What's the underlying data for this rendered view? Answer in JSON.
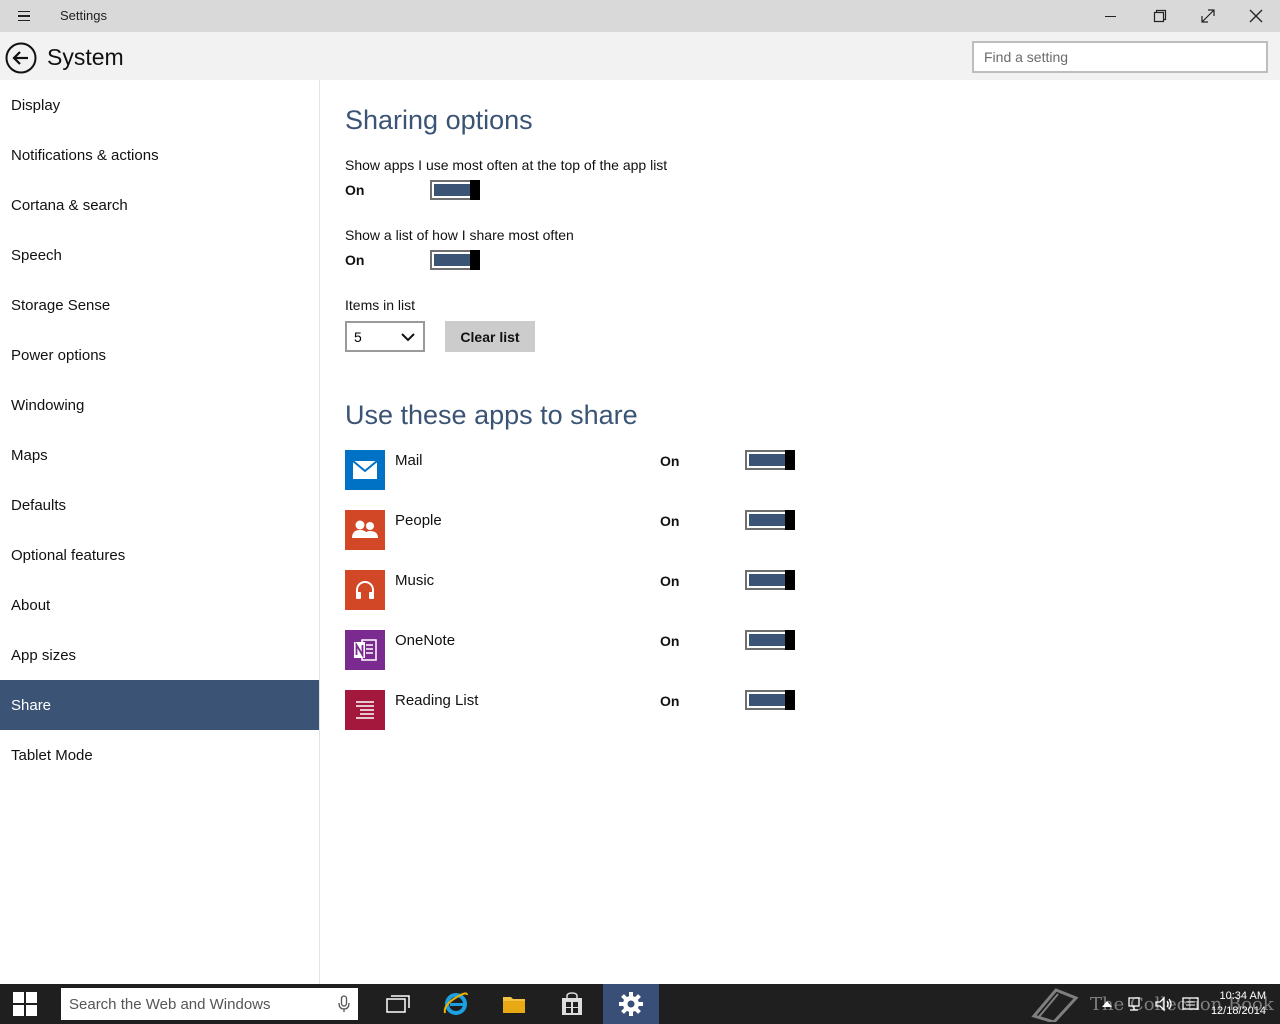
{
  "window": {
    "title": "Settings"
  },
  "header": {
    "title": "System",
    "search_placeholder": "Find a setting"
  },
  "sidebar": {
    "items": [
      {
        "label": "Display"
      },
      {
        "label": "Notifications & actions"
      },
      {
        "label": "Cortana & search"
      },
      {
        "label": "Speech"
      },
      {
        "label": "Storage Sense"
      },
      {
        "label": "Power options"
      },
      {
        "label": "Windowing"
      },
      {
        "label": "Maps"
      },
      {
        "label": "Defaults"
      },
      {
        "label": "Optional features"
      },
      {
        "label": "About"
      },
      {
        "label": "App sizes"
      },
      {
        "label": "Share",
        "selected": true
      },
      {
        "label": "Tablet Mode"
      }
    ]
  },
  "sharing": {
    "title": "Sharing options",
    "option1": {
      "label": "Show apps I use most often at the top of the app list",
      "state": "On",
      "enabled": true
    },
    "option2": {
      "label": "Show a list of how I share most often",
      "state": "On",
      "enabled": true
    },
    "items_label": "Items in list",
    "items_value": "5",
    "clear_label": "Clear list"
  },
  "apps": {
    "title": "Use these apps to share",
    "list": [
      {
        "name": "Mail",
        "state": "On",
        "icon": "mail-icon",
        "color": "#0072c6"
      },
      {
        "name": "People",
        "state": "On",
        "icon": "people-icon",
        "color": "#d24726"
      },
      {
        "name": "Music",
        "state": "On",
        "icon": "music-icon",
        "color": "#d24726"
      },
      {
        "name": "OneNote",
        "state": "On",
        "icon": "onenote-icon",
        "color": "#7b2a8f"
      },
      {
        "name": "Reading List",
        "state": "On",
        "icon": "reading-list-icon",
        "color": "#a4183e"
      }
    ]
  },
  "taskbar": {
    "search_placeholder": "Search the Web and Windows",
    "time": "10:34 AM",
    "date": "12/18/2014",
    "watermark": "The Collection Book"
  },
  "colors": {
    "accent": "#3b5475",
    "taskbar": "#1f1f1f",
    "titlebar": "#d9d9d9"
  }
}
